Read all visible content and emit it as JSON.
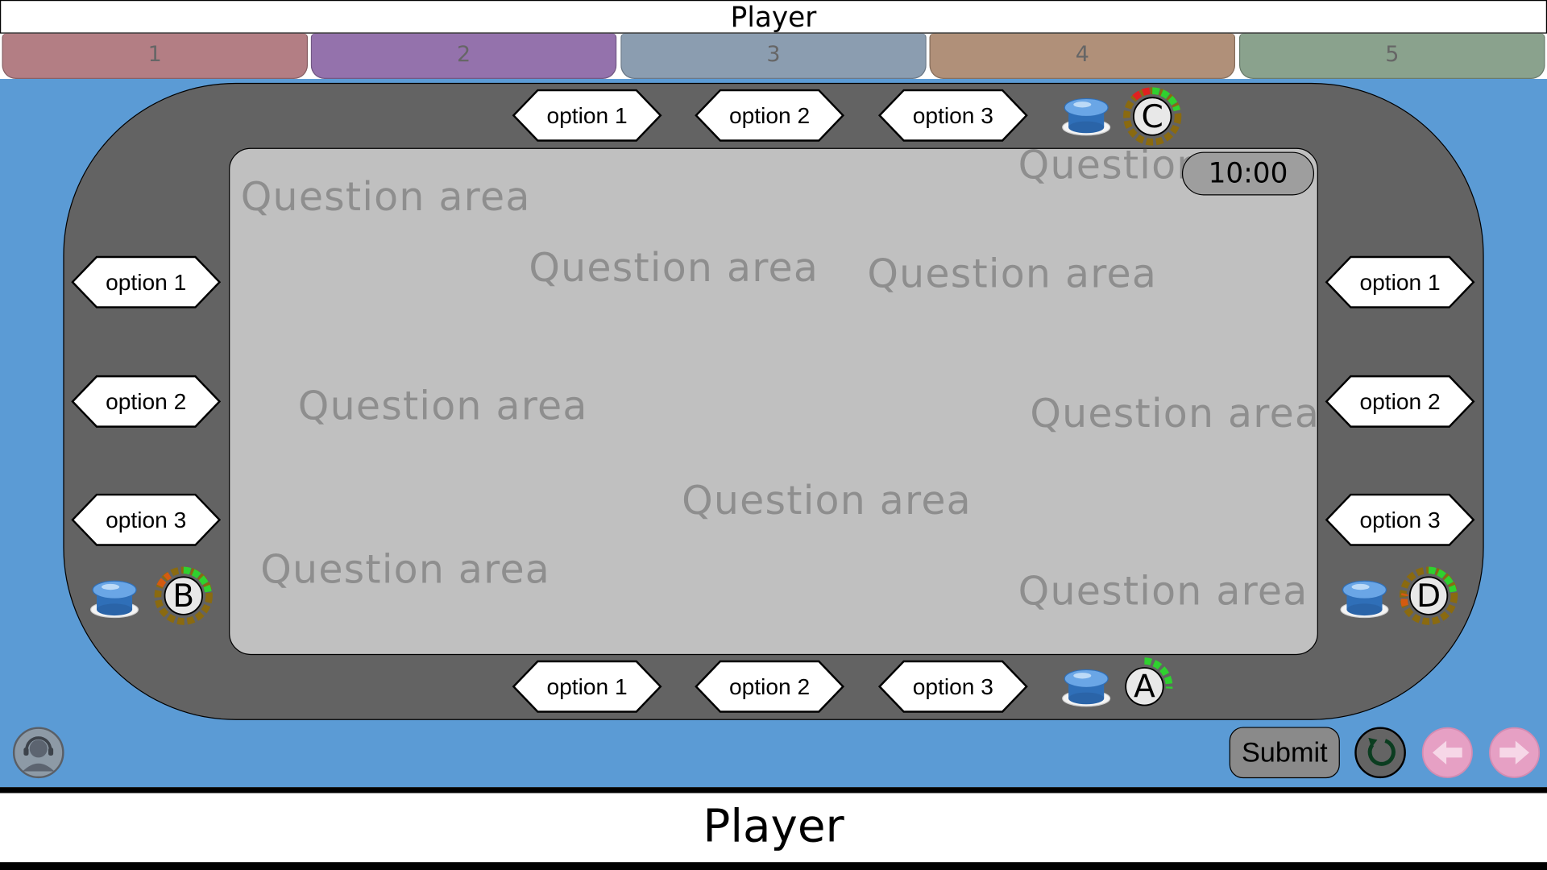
{
  "header": {
    "title": "Player"
  },
  "tabs": [
    {
      "label": "1",
      "color": "#b37e84"
    },
    {
      "label": "2",
      "color": "#9472ac"
    },
    {
      "label": "3",
      "color": "#8b9db0"
    },
    {
      "label": "4",
      "color": "#b09079"
    },
    {
      "label": "5",
      "color": "#8aa28d"
    }
  ],
  "question_area": {
    "timer": "10:00",
    "texts": [
      "Question area",
      "Question area",
      "Question area",
      "Question area",
      "Question area",
      "Question area",
      "Question area",
      "Question area",
      "Question"
    ]
  },
  "players": {
    "top": {
      "badge": "C",
      "options": [
        "option 1",
        "option 2",
        "option 3"
      ]
    },
    "left": {
      "badge": "B",
      "options": [
        "option 1",
        "option 2",
        "option 3"
      ]
    },
    "right": {
      "badge": "D",
      "options": [
        "option 1",
        "option 2",
        "option 3"
      ]
    },
    "bottom": {
      "badge": "A",
      "options": [
        "option 1",
        "option 2",
        "option 3"
      ]
    }
  },
  "controls": {
    "submit_label": "Submit",
    "icons": {
      "avatar": "headset-avatar-icon",
      "reset": "reset-icon",
      "back": "arrow-left-icon",
      "forward": "arrow-right-icon"
    }
  },
  "footer": {
    "title": "Player"
  },
  "colors": {
    "background": "#5b9bd5",
    "track": "#636363",
    "panel": "#c0c0c0",
    "nav_buttons": "#e6a0c4"
  }
}
